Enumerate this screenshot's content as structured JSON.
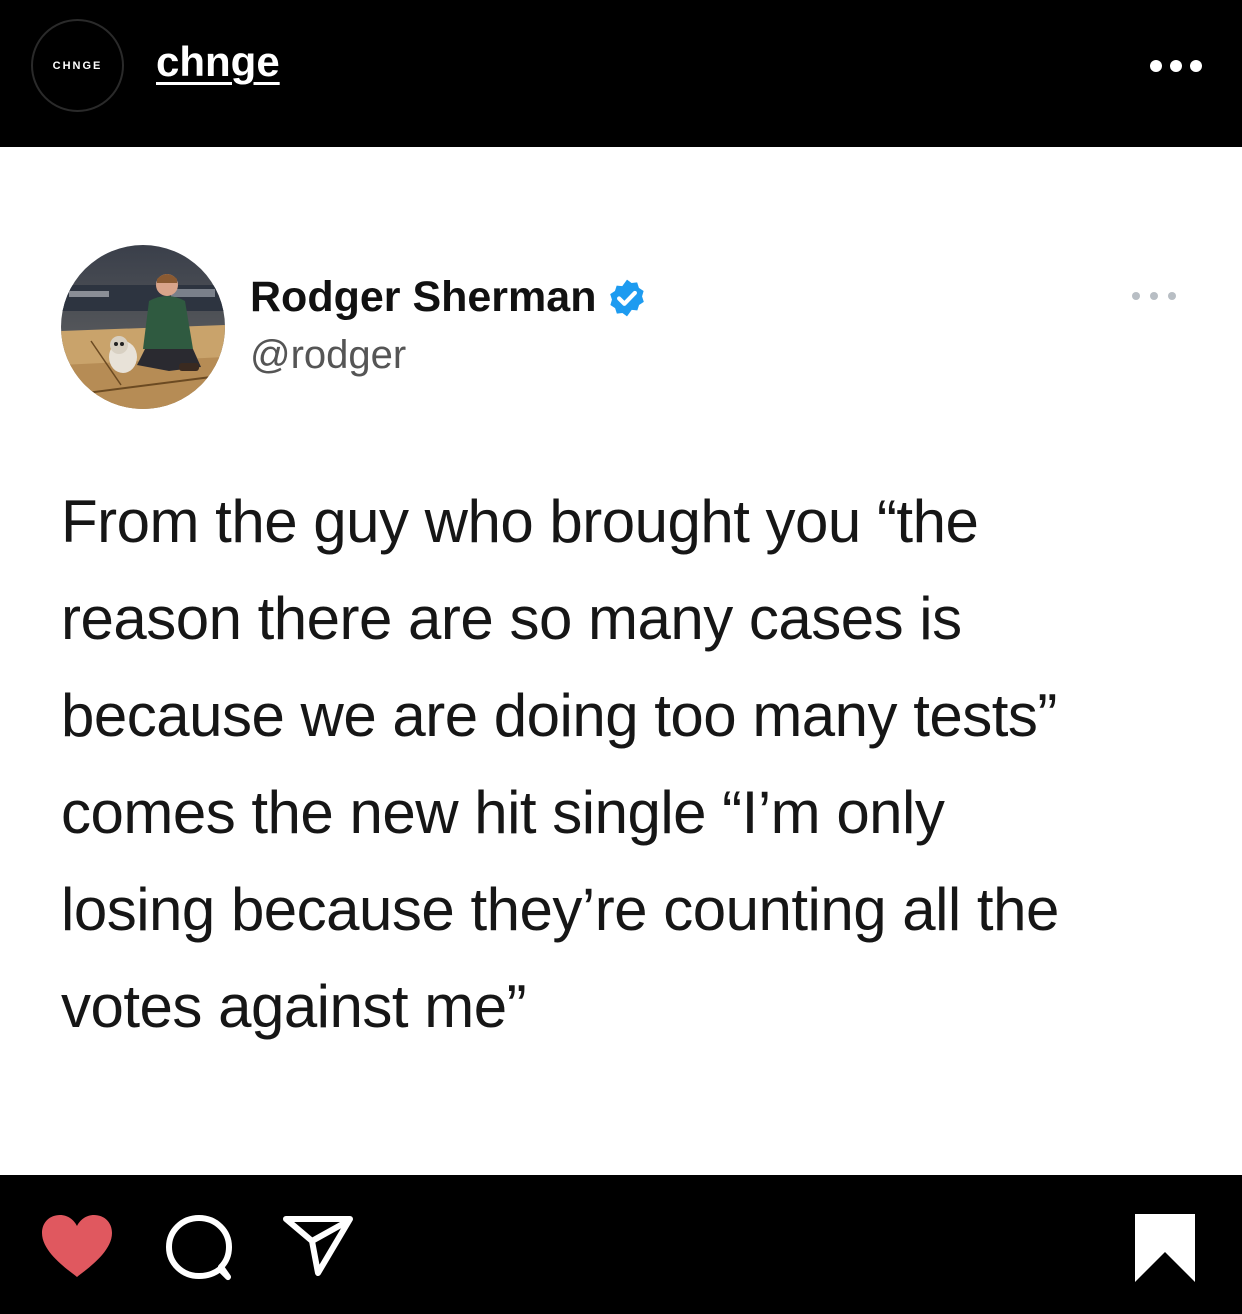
{
  "header": {
    "avatar_text": "CHNGE",
    "account_name": "chnge",
    "more_icon": "ellipsis-icon"
  },
  "tweet": {
    "display_name": "Rodger Sherman",
    "handle": "@rodger",
    "verified_color": "#1d9bf0",
    "text": "From the guy who brought you “the\nreason there are so many cases is\nbecause we are doing too many tests”\ncomes the new hit single “I’m only\nlosing because they’re counting all the\nvotes against me”"
  },
  "actions": {
    "like_icon": "heart-icon",
    "like_color": "#e0585f",
    "comment_icon": "comment-icon",
    "share_icon": "send-icon",
    "save_icon": "bookmark-icon"
  },
  "colors": {
    "frame": "#000000",
    "post_background": "#ffffff",
    "text": "#161616",
    "handle": "#555555"
  }
}
